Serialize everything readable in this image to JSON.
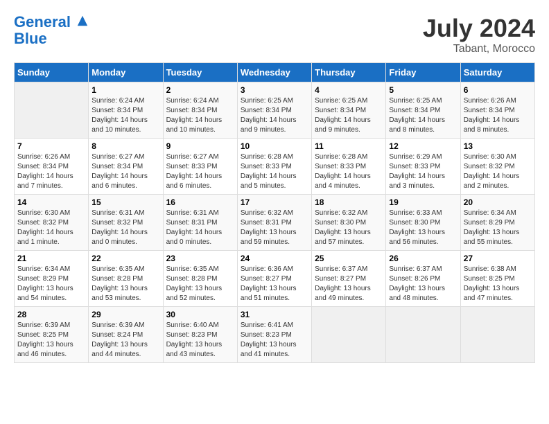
{
  "header": {
    "logo_line1": "General",
    "logo_line2": "Blue",
    "month": "July 2024",
    "location": "Tabant, Morocco"
  },
  "days_of_week": [
    "Sunday",
    "Monday",
    "Tuesday",
    "Wednesday",
    "Thursday",
    "Friday",
    "Saturday"
  ],
  "weeks": [
    [
      {
        "num": "",
        "info": ""
      },
      {
        "num": "1",
        "info": "Sunrise: 6:24 AM\nSunset: 8:34 PM\nDaylight: 14 hours\nand 10 minutes."
      },
      {
        "num": "2",
        "info": "Sunrise: 6:24 AM\nSunset: 8:34 PM\nDaylight: 14 hours\nand 10 minutes."
      },
      {
        "num": "3",
        "info": "Sunrise: 6:25 AM\nSunset: 8:34 PM\nDaylight: 14 hours\nand 9 minutes."
      },
      {
        "num": "4",
        "info": "Sunrise: 6:25 AM\nSunset: 8:34 PM\nDaylight: 14 hours\nand 9 minutes."
      },
      {
        "num": "5",
        "info": "Sunrise: 6:25 AM\nSunset: 8:34 PM\nDaylight: 14 hours\nand 8 minutes."
      },
      {
        "num": "6",
        "info": "Sunrise: 6:26 AM\nSunset: 8:34 PM\nDaylight: 14 hours\nand 8 minutes."
      }
    ],
    [
      {
        "num": "7",
        "info": "Sunrise: 6:26 AM\nSunset: 8:34 PM\nDaylight: 14 hours\nand 7 minutes."
      },
      {
        "num": "8",
        "info": "Sunrise: 6:27 AM\nSunset: 8:34 PM\nDaylight: 14 hours\nand 6 minutes."
      },
      {
        "num": "9",
        "info": "Sunrise: 6:27 AM\nSunset: 8:33 PM\nDaylight: 14 hours\nand 6 minutes."
      },
      {
        "num": "10",
        "info": "Sunrise: 6:28 AM\nSunset: 8:33 PM\nDaylight: 14 hours\nand 5 minutes."
      },
      {
        "num": "11",
        "info": "Sunrise: 6:28 AM\nSunset: 8:33 PM\nDaylight: 14 hours\nand 4 minutes."
      },
      {
        "num": "12",
        "info": "Sunrise: 6:29 AM\nSunset: 8:33 PM\nDaylight: 14 hours\nand 3 minutes."
      },
      {
        "num": "13",
        "info": "Sunrise: 6:30 AM\nSunset: 8:32 PM\nDaylight: 14 hours\nand 2 minutes."
      }
    ],
    [
      {
        "num": "14",
        "info": "Sunrise: 6:30 AM\nSunset: 8:32 PM\nDaylight: 14 hours\nand 1 minute."
      },
      {
        "num": "15",
        "info": "Sunrise: 6:31 AM\nSunset: 8:32 PM\nDaylight: 14 hours\nand 0 minutes."
      },
      {
        "num": "16",
        "info": "Sunrise: 6:31 AM\nSunset: 8:31 PM\nDaylight: 14 hours\nand 0 minutes."
      },
      {
        "num": "17",
        "info": "Sunrise: 6:32 AM\nSunset: 8:31 PM\nDaylight: 13 hours\nand 59 minutes."
      },
      {
        "num": "18",
        "info": "Sunrise: 6:32 AM\nSunset: 8:30 PM\nDaylight: 13 hours\nand 57 minutes."
      },
      {
        "num": "19",
        "info": "Sunrise: 6:33 AM\nSunset: 8:30 PM\nDaylight: 13 hours\nand 56 minutes."
      },
      {
        "num": "20",
        "info": "Sunrise: 6:34 AM\nSunset: 8:29 PM\nDaylight: 13 hours\nand 55 minutes."
      }
    ],
    [
      {
        "num": "21",
        "info": "Sunrise: 6:34 AM\nSunset: 8:29 PM\nDaylight: 13 hours\nand 54 minutes."
      },
      {
        "num": "22",
        "info": "Sunrise: 6:35 AM\nSunset: 8:28 PM\nDaylight: 13 hours\nand 53 minutes."
      },
      {
        "num": "23",
        "info": "Sunrise: 6:35 AM\nSunset: 8:28 PM\nDaylight: 13 hours\nand 52 minutes."
      },
      {
        "num": "24",
        "info": "Sunrise: 6:36 AM\nSunset: 8:27 PM\nDaylight: 13 hours\nand 51 minutes."
      },
      {
        "num": "25",
        "info": "Sunrise: 6:37 AM\nSunset: 8:27 PM\nDaylight: 13 hours\nand 49 minutes."
      },
      {
        "num": "26",
        "info": "Sunrise: 6:37 AM\nSunset: 8:26 PM\nDaylight: 13 hours\nand 48 minutes."
      },
      {
        "num": "27",
        "info": "Sunrise: 6:38 AM\nSunset: 8:25 PM\nDaylight: 13 hours\nand 47 minutes."
      }
    ],
    [
      {
        "num": "28",
        "info": "Sunrise: 6:39 AM\nSunset: 8:25 PM\nDaylight: 13 hours\nand 46 minutes."
      },
      {
        "num": "29",
        "info": "Sunrise: 6:39 AM\nSunset: 8:24 PM\nDaylight: 13 hours\nand 44 minutes."
      },
      {
        "num": "30",
        "info": "Sunrise: 6:40 AM\nSunset: 8:23 PM\nDaylight: 13 hours\nand 43 minutes."
      },
      {
        "num": "31",
        "info": "Sunrise: 6:41 AM\nSunset: 8:23 PM\nDaylight: 13 hours\nand 41 minutes."
      },
      {
        "num": "",
        "info": ""
      },
      {
        "num": "",
        "info": ""
      },
      {
        "num": "",
        "info": ""
      }
    ]
  ]
}
